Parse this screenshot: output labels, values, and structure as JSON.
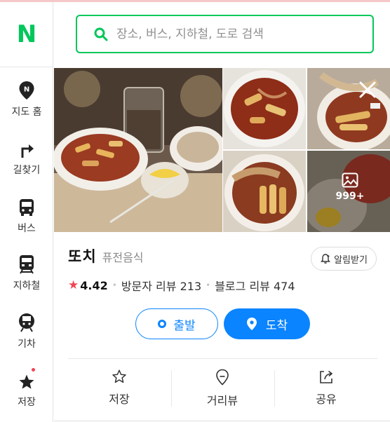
{
  "app": {
    "logo": "N",
    "brand_color": "#03c75a",
    "accent_color": "#0a84ff"
  },
  "sidebar": {
    "items": [
      {
        "label": "지도 홈",
        "icon": "map-pin-icon"
      },
      {
        "label": "길찾기",
        "icon": "directions-icon"
      },
      {
        "label": "버스",
        "icon": "bus-icon"
      },
      {
        "label": "지하철",
        "icon": "subway-icon"
      },
      {
        "label": "기차",
        "icon": "train-icon"
      },
      {
        "label": "저장",
        "icon": "star-icon",
        "has_new_dot": true
      }
    ]
  },
  "search": {
    "placeholder": "장소, 버스, 지하철, 도로 검색",
    "value": ""
  },
  "photos": {
    "more_count": "999+"
  },
  "place": {
    "name": "또치",
    "category": "퓨전음식",
    "rating": "4.42",
    "visitor_reviews": "방문자 리뷰 213",
    "blog_reviews": "블로그 리뷰 474",
    "alarm_label": "알림받기"
  },
  "route": {
    "depart_label": "출발",
    "arrive_label": "도착"
  },
  "actions": {
    "save_label": "저장",
    "street_view_label": "거리뷰",
    "share_label": "공유"
  }
}
